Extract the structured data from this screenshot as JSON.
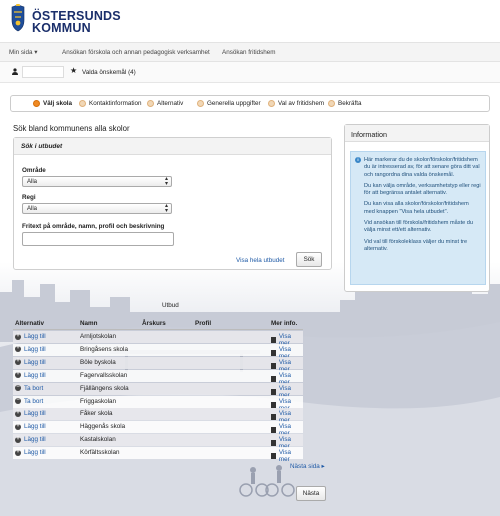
{
  "brand": {
    "line1": "ÖSTERSUNDS",
    "line2": "KOMMUN"
  },
  "topnav": {
    "items": [
      "Min sida ▾",
      "Ansökan förskola och annan pedagogisk verksamhet",
      "Ansökan fritidshem"
    ]
  },
  "userbar": {
    "chosen_label": "Valda önskemål (4)"
  },
  "steps": [
    "Välj skola",
    "Kontaktinformation",
    "Alternativ",
    "Generella uppgifter",
    "Val av fritidshem",
    "Bekräfta"
  ],
  "search": {
    "title": "Sök bland kommunens alla skolor",
    "panel_title": "Sök i utbudet",
    "area_label": "Område",
    "area_value": "Alla",
    "regi_label": "Regi",
    "regi_value": "Alla",
    "freetext_label": "Fritext på område, namn, profil och beskrivning",
    "freetext_value": "",
    "show_all_link": "Visa hela utbudet",
    "search_button": "Sök"
  },
  "info": {
    "title": "Information",
    "paragraphs": [
      "Här markerar du de skolor/förskolor/fritidshem du är intresserad av, för att senare göra ditt val och rangordna dina valda önskemål.",
      "Du kan välja område, verksamhetstyp eller regi för att begränsa antalet alternativ.",
      "Du kan visa alla skolor/förskolor/fritidshem med knappen \"Visa hela utbudet\".",
      "Vid ansökan till förskola/fritidshem måste du välja minst ett/ett alternativ.",
      "Vid val till förskoleklass väljer du minst tre alternativ."
    ]
  },
  "results": {
    "caption": "Utbud",
    "columns": [
      "Alternativ",
      "Namn",
      "Årskurs",
      "Profil",
      "Mer info."
    ],
    "rows": [
      {
        "action": "Lägg till",
        "symbol": "+",
        "name": "Arnljotskolan",
        "more": "Visa mer"
      },
      {
        "action": "Lägg till",
        "symbol": "+",
        "name": "Bringåsens skola",
        "more": "Visa mer"
      },
      {
        "action": "Lägg till",
        "symbol": "+",
        "name": "Böle byskola",
        "more": "Visa mer"
      },
      {
        "action": "Lägg till",
        "symbol": "+",
        "name": "Fagervallsskolan",
        "more": "Visa mer"
      },
      {
        "action": "Ta bort",
        "symbol": "−",
        "name": "Fjällängens skola",
        "more": "Visa mer"
      },
      {
        "action": "Ta bort",
        "symbol": "−",
        "name": "Friggaskolan",
        "more": "Visa mer"
      },
      {
        "action": "Lägg till",
        "symbol": "+",
        "name": "Fåker skola",
        "more": "Visa mer"
      },
      {
        "action": "Lägg till",
        "symbol": "+",
        "name": "Häggenås skola",
        "more": "Visa mer"
      },
      {
        "action": "Lägg till",
        "symbol": "+",
        "name": "Kastalskolan",
        "more": "Visa mer"
      },
      {
        "action": "Lägg till",
        "symbol": "+",
        "name": "Körfältsskolan",
        "more": "Visa mer"
      }
    ],
    "next_link": "Nästa sida ▸",
    "next_button": "Nästa"
  }
}
